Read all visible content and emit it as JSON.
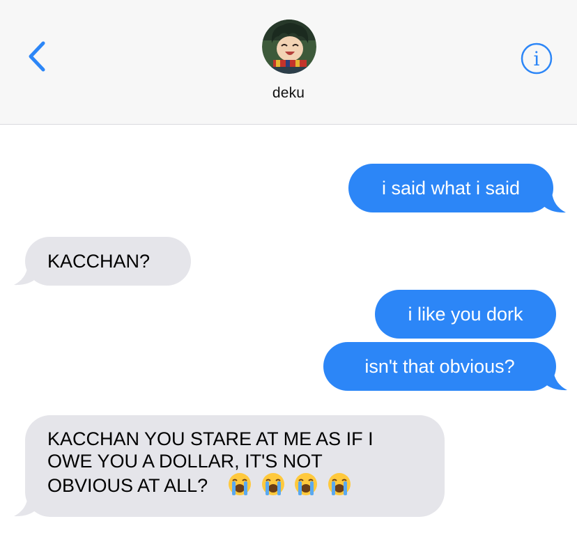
{
  "header": {
    "contact_name": "deku",
    "back_icon": "chevron-left-icon",
    "info_icon": "info-icon",
    "accent_color": "#2c86f7"
  },
  "messages": [
    {
      "direction": "sent",
      "text": "i said what i said"
    },
    {
      "direction": "received",
      "text": "KACCHAN?"
    },
    {
      "direction": "sent",
      "text": "i like you dork"
    },
    {
      "direction": "sent",
      "text": "isn't that obvious?"
    },
    {
      "direction": "received",
      "lines": [
        "KACCHAN YOU STARE AT ME AS IF I",
        "OWE YOU A DOLLAR, IT'S NOT",
        "OBVIOUS AT ALL?"
      ],
      "emoji": [
        "loudly-crying-face",
        "loudly-crying-face",
        "loudly-crying-face",
        "loudly-crying-face"
      ]
    }
  ],
  "colors": {
    "sent_bubble": "#2c86f7",
    "received_bubble": "#e5e5ea",
    "header_bg": "#f7f7f7"
  }
}
